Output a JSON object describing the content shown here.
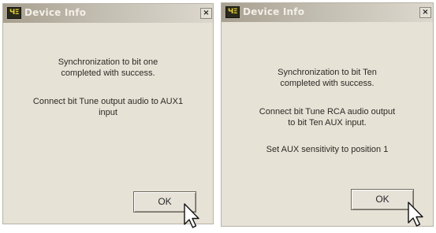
{
  "dialogs": [
    {
      "title": "Device Info",
      "icon_text": "ЧΞ",
      "close": "×",
      "paragraphs": [
        [
          "Synchronization to bit one",
          "completed with success."
        ],
        [
          "Connect bit Tune output audio to AUX1",
          "input"
        ]
      ],
      "ok_label": "OK"
    },
    {
      "title": "Device Info",
      "icon_text": "ЧΞ",
      "close": "×",
      "paragraphs": [
        [
          "Synchronization to bit Ten",
          "completed with success."
        ],
        [
          "Connect bit Tune RCA audio output",
          "to bit Ten AUX input."
        ],
        [
          "Set AUX sensitivity to position 1"
        ]
      ],
      "ok_label": "OK"
    }
  ],
  "icons": {
    "app": "app-icon",
    "close": "close-icon",
    "cursor": "mouse-pointer-icon"
  },
  "colors": {
    "dialog_bg": "#e7e2d6",
    "titlebar_start": "#a79f8f",
    "titlebar_end": "#ddd8cd",
    "title_text": "#f2efe8",
    "icon_bg": "#2a2a1c",
    "icon_fg": "#e8d227"
  }
}
